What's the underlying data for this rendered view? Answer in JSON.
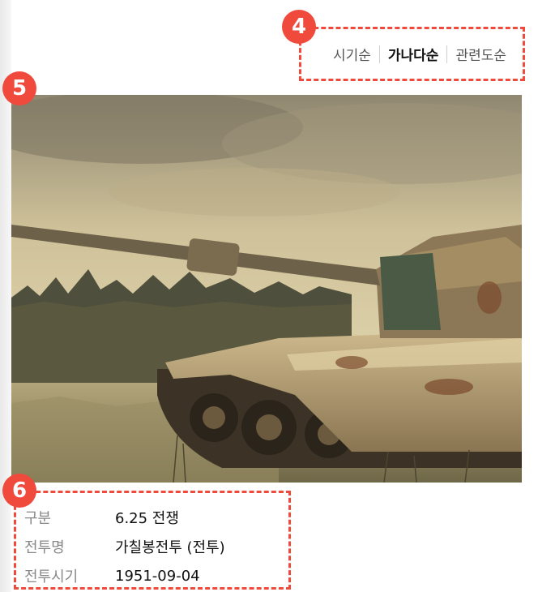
{
  "markers": {
    "sort": "4",
    "image": "5",
    "info": "6"
  },
  "sort_options": [
    {
      "label": "시기순",
      "active": false
    },
    {
      "label": "가나다순",
      "active": true
    },
    {
      "label": "관련도순",
      "active": false
    }
  ],
  "image": {
    "subject": "rusted-tank-in-field"
  },
  "info": {
    "rows": [
      {
        "label": "구분",
        "value": "6.25 전쟁"
      },
      {
        "label": "전투명",
        "value": "가칠봉전투 (전투)"
      },
      {
        "label": "전투시기",
        "value": "1951-09-04"
      }
    ]
  },
  "colors": {
    "marker": "#f04a3c",
    "dashed_border": "#f04a3c"
  }
}
